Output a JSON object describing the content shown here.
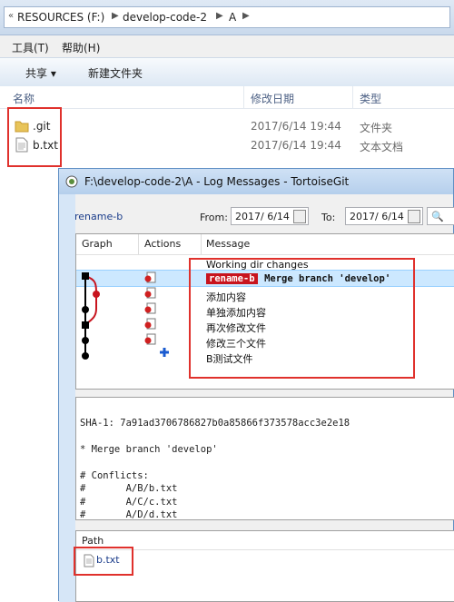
{
  "explorer": {
    "address": [
      "RESOURCES (F:)",
      "develop-code-2",
      "A"
    ],
    "menu": [
      "工具(T)",
      "帮助(H)"
    ],
    "commands": {
      "share": "共享 ▾",
      "new_folder": "新建文件夹"
    },
    "columns": {
      "name": "名称",
      "date": "修改日期",
      "type": "类型"
    },
    "files": [
      {
        "name": ".git",
        "date": "2017/6/14 19:44",
        "type": "文件夹"
      },
      {
        "name": "b.txt",
        "date": "2017/6/14 19:44",
        "type": "文本文档"
      }
    ]
  },
  "tortoise": {
    "title": "F:\\develop-code-2\\A - Log Messages - TortoiseGit",
    "branch": "rename-b",
    "from_label": "From:",
    "from_value": "2017/ 6/14",
    "to_label": "To:",
    "to_value": "2017/ 6/14",
    "log_columns": {
      "graph": "Graph",
      "actions": "Actions",
      "message": "Message"
    },
    "log_rows": [
      {
        "message": "Working dir changes"
      },
      {
        "tag": "rename-b",
        "message": "Merge branch 'develop'"
      },
      {
        "message": "添加内容"
      },
      {
        "message": "单独添加内容"
      },
      {
        "message": "再次修改文件"
      },
      {
        "message": "修改三个文件"
      },
      {
        "message": "B测试文件"
      }
    ],
    "detail": {
      "sha": "SHA-1: 7a91ad3706786827b0a85866f373578acc3e2e18",
      "subject": "* Merge branch 'develop'",
      "conflicts_label": "# Conflicts:",
      "conflicts": [
        "#       A/B/b.txt",
        "#       A/C/c.txt",
        "#       A/D/d.txt"
      ]
    },
    "path_header": "Path",
    "paths": [
      "b.txt"
    ]
  },
  "colors": {
    "highlight": "#e0312c",
    "tag_bg": "#c8141e",
    "selection": "#cce8ff",
    "link": "#1a3c8a"
  }
}
